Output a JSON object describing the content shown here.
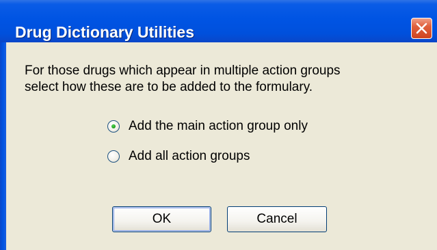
{
  "window": {
    "title": "Drug Dictionary Utilities"
  },
  "titlebar": {
    "close_icon": "close-icon"
  },
  "dialog": {
    "instruction_lines": [
      "For those drugs which appear in multiple action groups",
      "select how these are to be added to the formulary."
    ],
    "options": [
      {
        "label": "Add the main action group only",
        "selected": true
      },
      {
        "label": "Add all action groups",
        "selected": false
      }
    ]
  },
  "buttons": {
    "ok_label": "OK",
    "cancel_label": "Cancel"
  },
  "colors": {
    "titlebar": "#0054e3",
    "client_bg": "#ece9d8",
    "close_button": "#e0603c",
    "radio_dot": "#21a121"
  }
}
